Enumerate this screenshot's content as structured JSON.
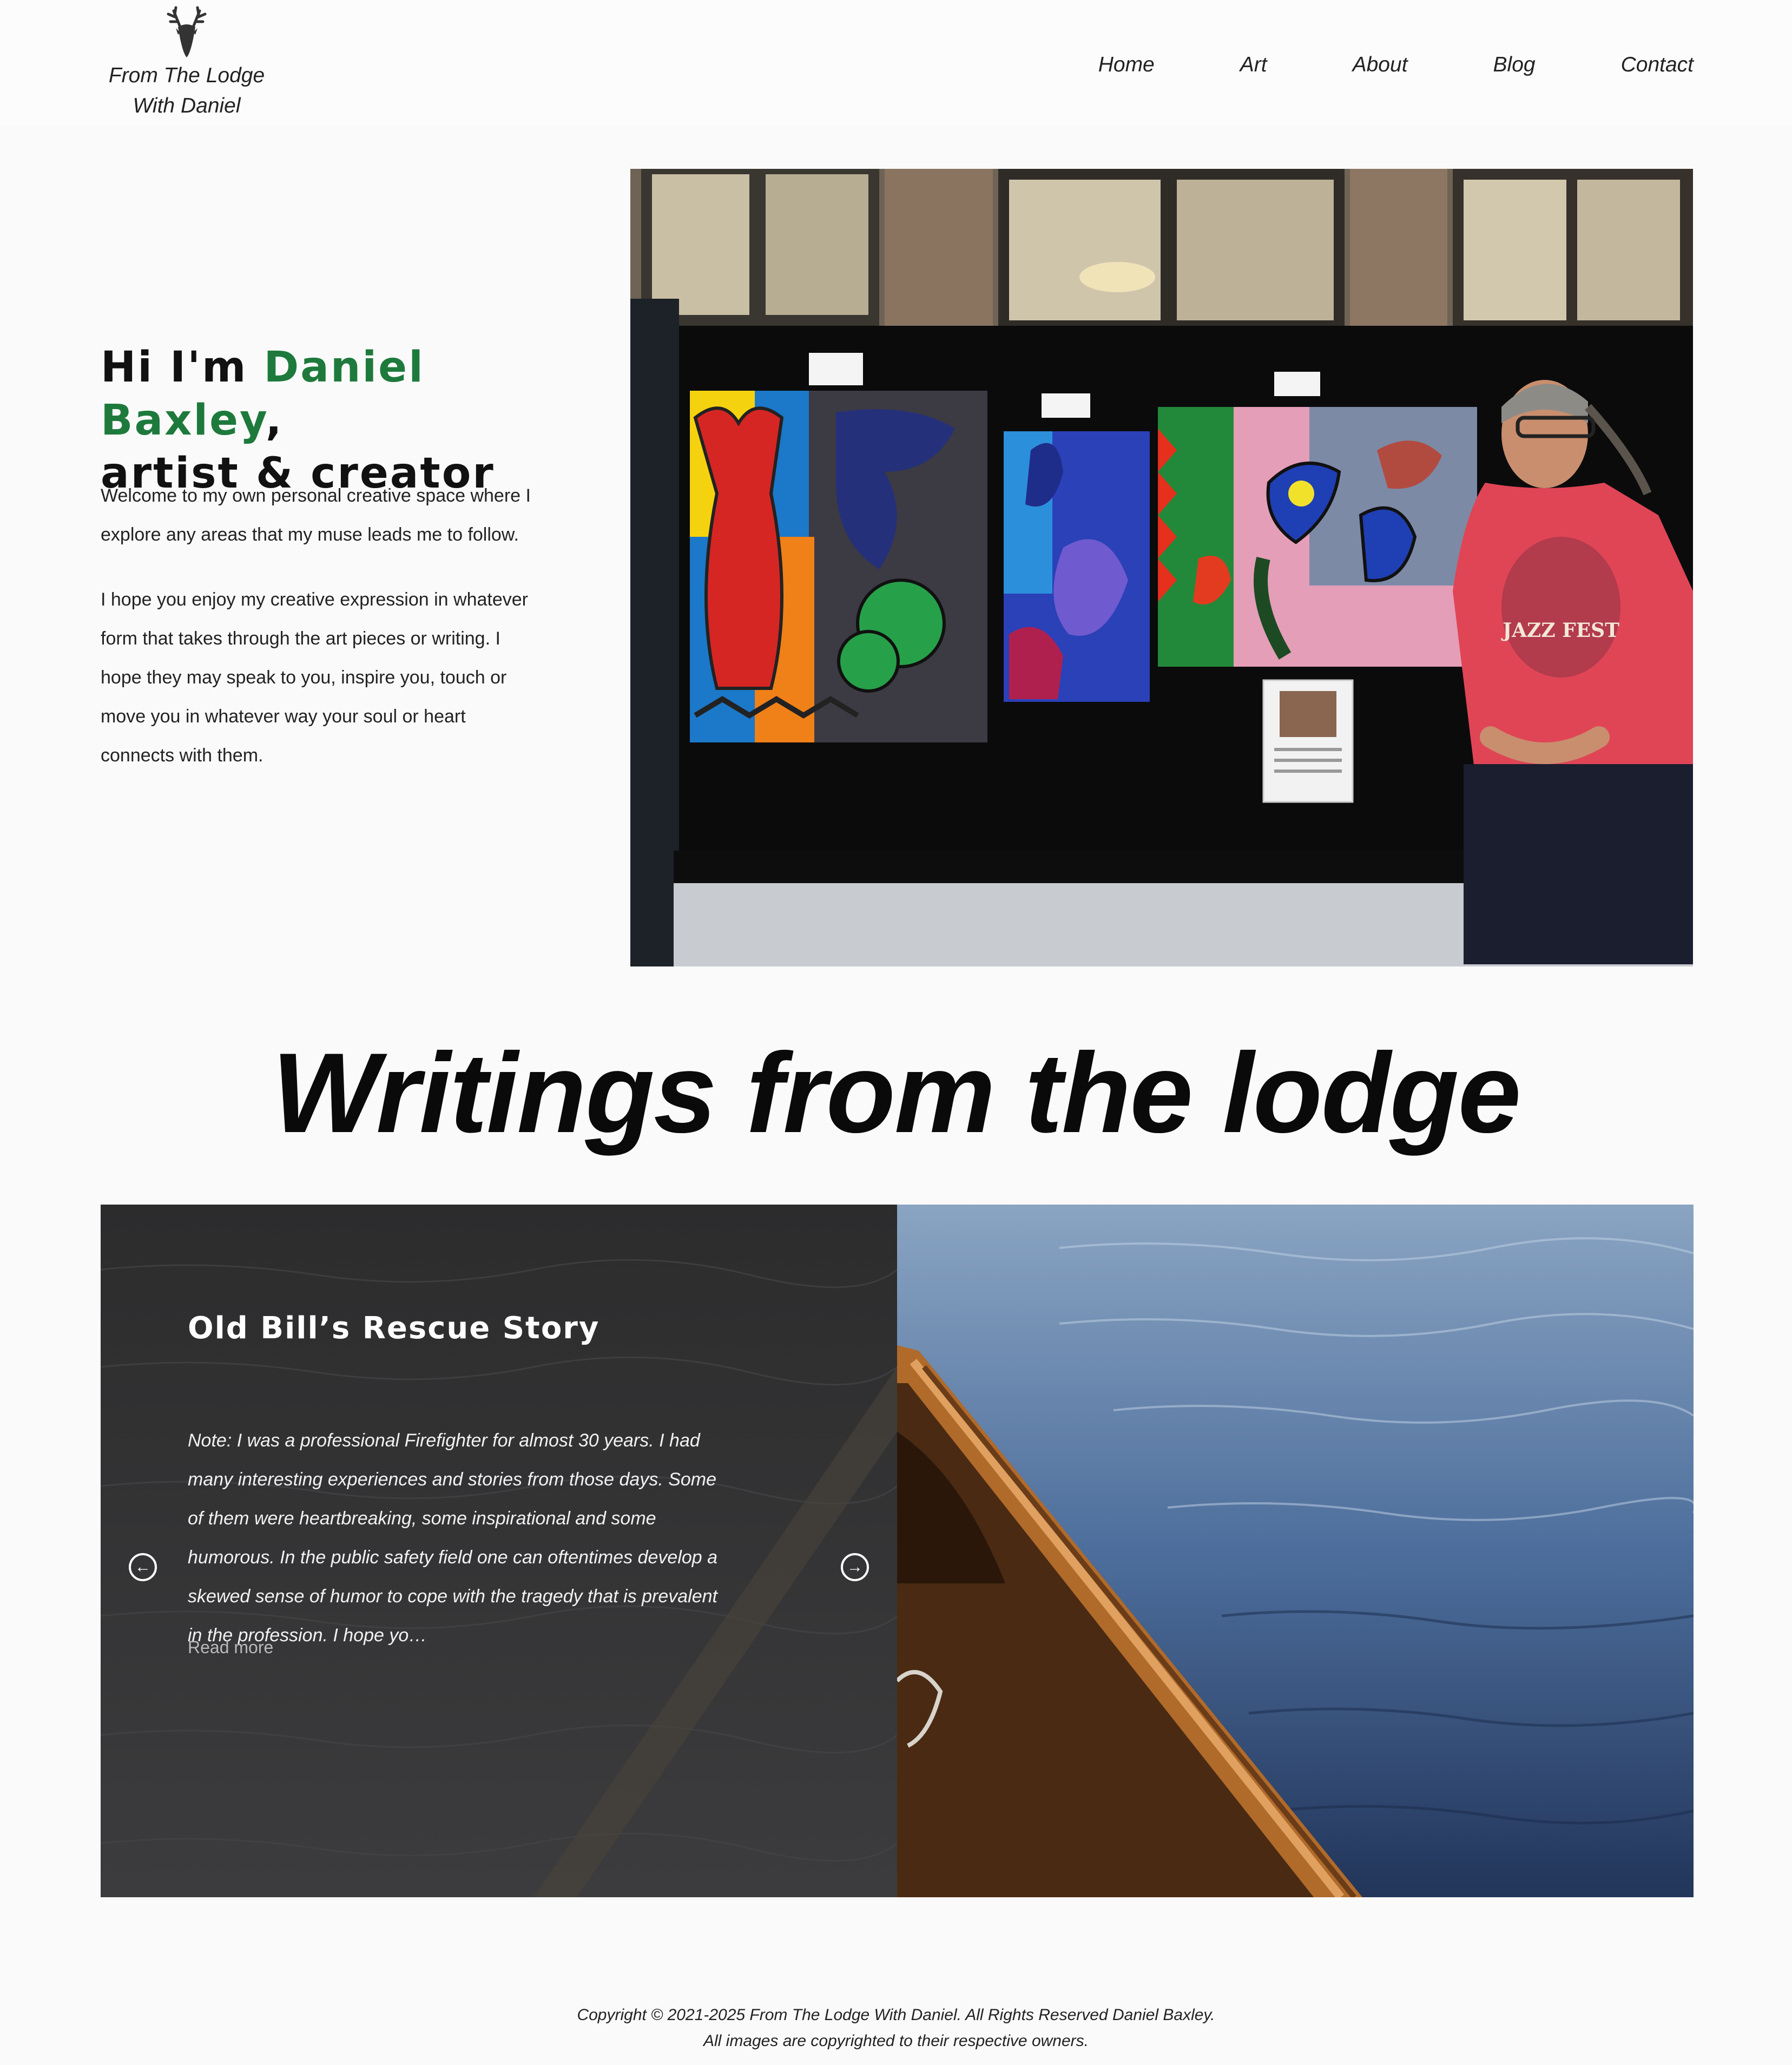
{
  "header": {
    "logo_line1": "From The Lodge",
    "logo_line2": "With Daniel",
    "nav": [
      "Home",
      "Art",
      "About",
      "Blog",
      "Contact"
    ]
  },
  "hero": {
    "greeting": "Hi I'm ",
    "name": "Daniel Baxley",
    "comma": ",",
    "subtitle": "artist & creator",
    "paragraph1": "Welcome to my own personal creative space where I explore any areas that my muse leads me to follow.",
    "paragraph2": "I hope you enjoy my creative expression in whatever form that takes through the art pieces or writing. I hope they may speak to you, inspire you, touch or move you in whatever way your soul or heart connects with them.",
    "photo_tshirt_text": "JAZZ FEST"
  },
  "writings": {
    "title": "Writings from the lodge",
    "post": {
      "title": "Old Bill’s Rescue Story",
      "excerpt": "Note: I was a professional Firefighter for almost 30 years. I had many interesting experiences and stories from those days. Some of them were heartbreaking, some inspirational and some humorous. In the public safety field one can oftentimes develop a skewed sense of humor to cope with the tragedy that is prevalent in the profession. I hope yo…",
      "read_more": "Read more"
    },
    "prev_icon": "arrow-left-circle-icon",
    "next_icon": "arrow-right-circle-icon"
  },
  "footer": {
    "line1": "Copyright © 2021-2025 From The Lodge With Daniel. All Rights Reserved Daniel Baxley.",
    "line2": "All images are copyrighted to their respective owners."
  },
  "colors": {
    "accent_green": "#1e7a3c",
    "post_panel": "#3a3a3b",
    "background": "#fafafa"
  }
}
